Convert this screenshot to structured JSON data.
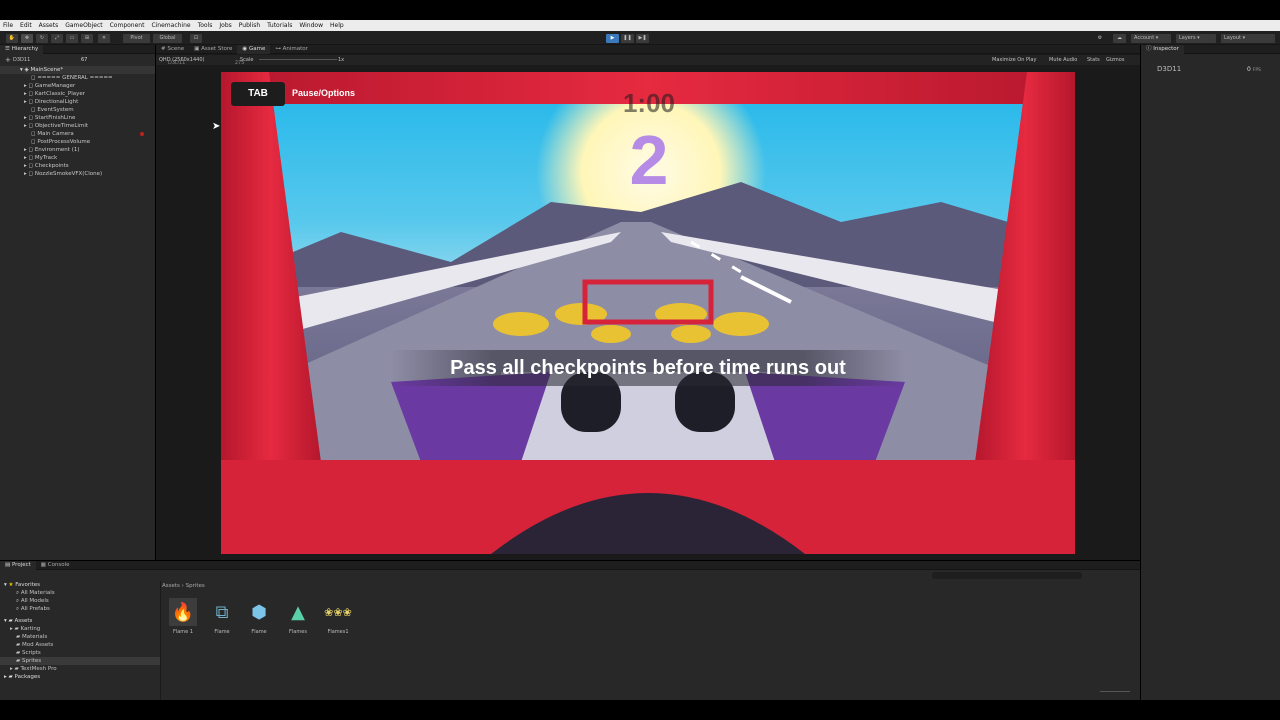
{
  "menu": [
    "File",
    "Edit",
    "Assets",
    "GameObject",
    "Component",
    "Cinemachine",
    "Tools",
    "Jobs",
    "Publish",
    "Tutorials",
    "Window",
    "Help"
  ],
  "toolbar": {
    "pivot": "Pivot",
    "global": "Global",
    "account": "Account",
    "layers": "Layers",
    "layout": "Layout"
  },
  "hierarchy": {
    "tab": "Hierarchy",
    "search_value": "D3D11",
    "fps": "67",
    "items": [
      "MainScene*",
      "===== GENERAL =====",
      "GameManager",
      "KartClassic_Player",
      "DirectionalLight",
      "EventSystem",
      "StartFinishLine",
      "ObjectiveTimeLimit",
      "Main Camera",
      "PostProcessVolume",
      "Environment (1)",
      "MyTrack",
      "Checkpoints",
      "NozzleSmokeVFX(Clone)"
    ]
  },
  "scene_tabs": [
    "Scene",
    "Asset Store",
    "Game",
    "Animator"
  ],
  "game_bar": {
    "resolution": "QHD (2560x1440)",
    "scale_label": "Scale",
    "scale_value": "1x",
    "overlay": "D3D11",
    "overlay_sub": "275",
    "options": [
      "Maximize On Play",
      "Mute Audio",
      "Stats",
      "Gizmos"
    ]
  },
  "game": {
    "tab_key": "TAB",
    "pause_label": "Pause/Options",
    "timer": "1:00",
    "countdown": "2",
    "objective": "Pass all checkpoints before time runs out"
  },
  "inspector": {
    "tab": "Inspector",
    "label": "D3D11",
    "fps_value": "0",
    "fps_unit": "FPS"
  },
  "project": {
    "tabs": [
      "Project",
      "Console"
    ],
    "breadcrumb": [
      "Assets",
      "Sprites"
    ],
    "favorites_label": "Favorites",
    "favorites": [
      "All Materials",
      "All Models",
      "All Prefabs"
    ],
    "assets_label": "Assets",
    "folders": [
      "Karting",
      "Materials",
      "Mod Assets",
      "Scripts",
      "Sprites",
      "TextMesh Pro"
    ],
    "packages_label": "Packages",
    "items": [
      {
        "label": "Flame 1",
        "icon": "flame-sprite-icon"
      },
      {
        "label": "Flame",
        "icon": "flame-graph-icon"
      },
      {
        "label": "Flame",
        "icon": "cube-prefab-icon"
      },
      {
        "label": "Flames",
        "icon": "triangle-sprite-icon"
      },
      {
        "label": "Flames1",
        "icon": "flames-sheet-icon"
      }
    ]
  },
  "colors": {
    "accent": "#3a79bb",
    "play": "#4b8ed8",
    "kart_red": "#d7233a"
  }
}
